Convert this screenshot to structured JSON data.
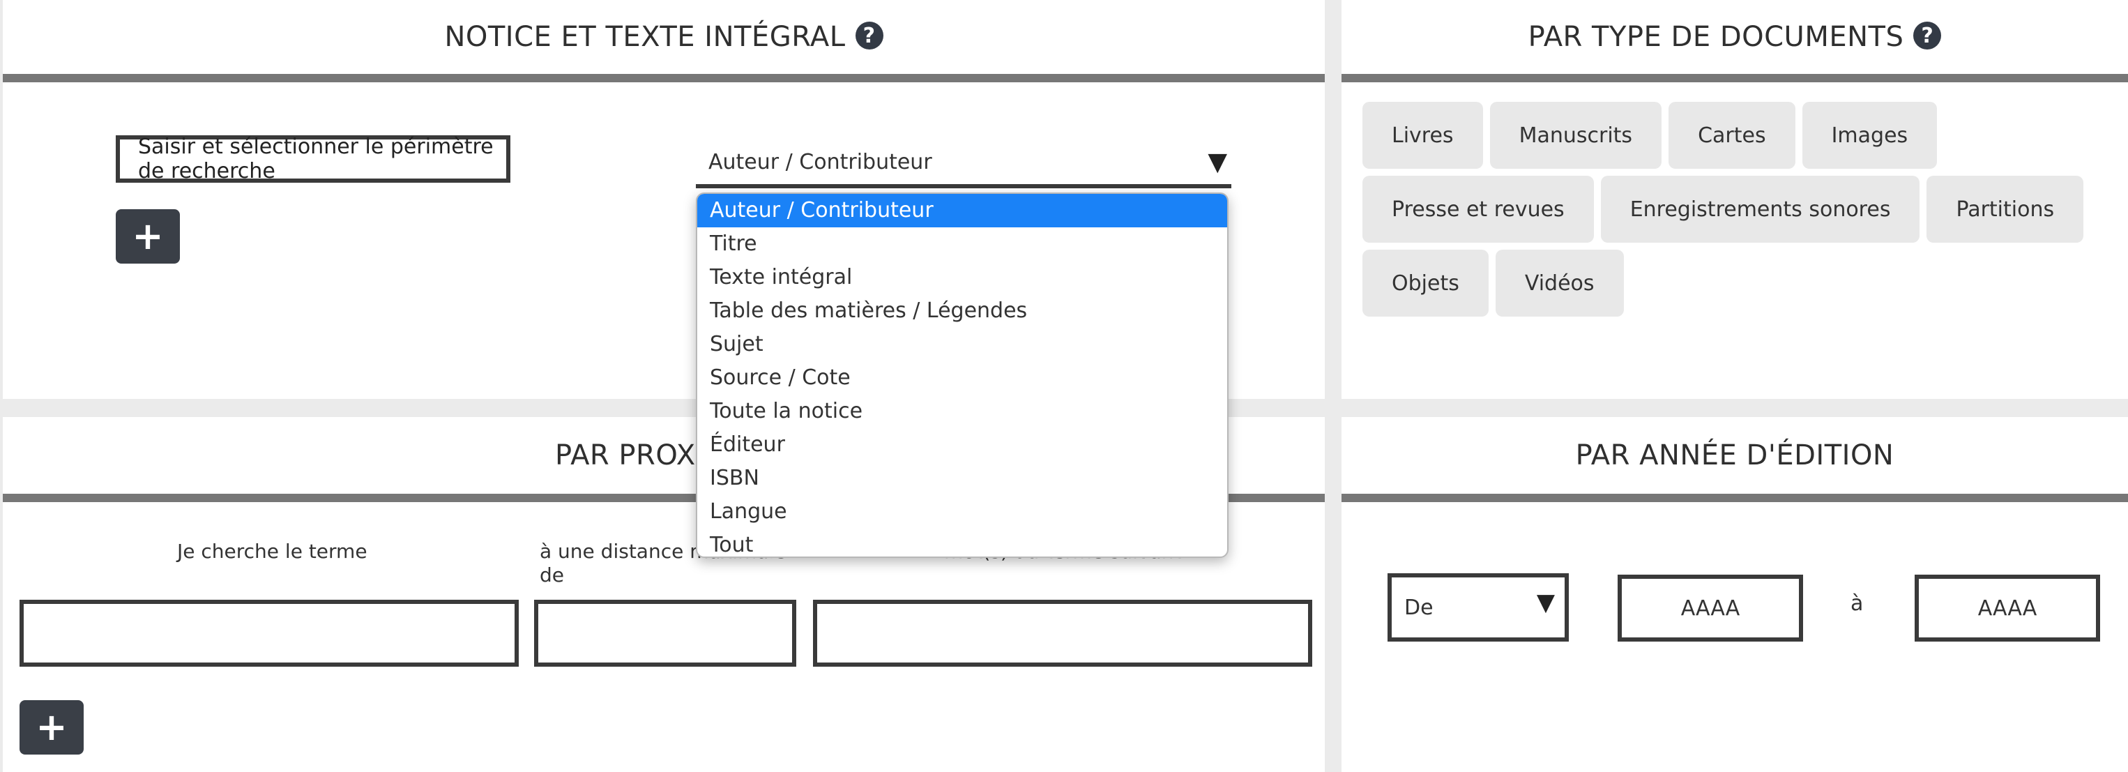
{
  "notice": {
    "title": "NOTICE ET TEXTE INTÉGRAL",
    "help_icon": "question-circle-icon",
    "scope_input_placeholder": "Saisir et sélectionner le périmètre de recherche",
    "add_icon": "plus-icon",
    "add_label": "+",
    "field_select_value": "Auteur / Contributeur",
    "field_select_arrow": "▼",
    "field_options": [
      "Auteur / Contributeur",
      "Titre",
      "Texte intégral",
      "Table des matières / Légendes",
      "Sujet",
      "Source / Cote",
      "Toute la notice",
      "Éditeur",
      "ISBN",
      "Langue",
      "Tout"
    ],
    "selected_option_index": 0
  },
  "types": {
    "title": "PAR TYPE DE DOCUMENTS",
    "help_icon": "question-circle-icon",
    "buttons": [
      "Livres",
      "Manuscrits",
      "Cartes",
      "Images",
      "Presse et revues",
      "Enregistrements sonores",
      "Partitions",
      "Objets",
      "Vidéos"
    ]
  },
  "proximity": {
    "title": "PAR PROXIMITÉ",
    "label_term": "Je cherche le terme",
    "label_distance": "à une distance maximale de",
    "label_next": "mot(s) du terme suivant",
    "add_label": "+"
  },
  "year": {
    "title": "PAR ANNÉE D'ÉDITION",
    "from_select": "De",
    "from_arrow": "▼",
    "from_placeholder": "AAAA",
    "to_label": "à",
    "to_placeholder": "AAAA"
  },
  "colors": {
    "dark_border": "#3a3a3a",
    "header_rule": "#777777",
    "button_dark": "#3a3f47",
    "select_highlight": "#1a82f7",
    "type_button_bg": "#e8e8e8"
  }
}
